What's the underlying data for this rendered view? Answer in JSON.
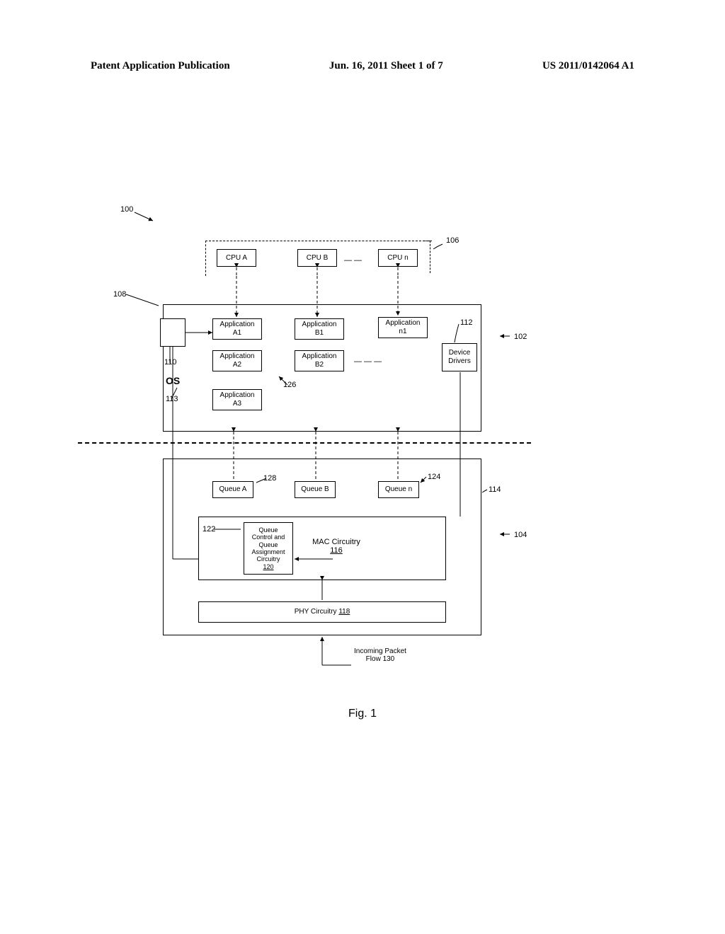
{
  "header": {
    "left": "Patent Application Publication",
    "center": "Jun. 16, 2011  Sheet 1 of 7",
    "right": "US 2011/0142064 A1"
  },
  "refs": {
    "r100": "100",
    "r106": "106",
    "r108": "108",
    "r102": "102",
    "r112": "112",
    "r110": "110",
    "r113": "113",
    "r126": "126",
    "r128": "128",
    "r124": "124",
    "r114": "114",
    "r104": "104",
    "r122": "122",
    "r116u": "116",
    "r120u": "120",
    "r118u": "118",
    "r130": "130"
  },
  "cpu": {
    "a": "CPU A",
    "b": "CPU B",
    "n": "CPU n"
  },
  "apps": {
    "a1": "Application\nA1",
    "a2": "Application\nA2",
    "a3": "Application\nA3",
    "b1": "Application\nB1",
    "b2": "Application\nB2",
    "n1": "Application\nn1"
  },
  "device_drivers": "Device\nDrivers",
  "os": "OS",
  "queues": {
    "a": "Queue A",
    "b": "Queue B",
    "n": "Queue n"
  },
  "qc": "Queue\nControl and\nQueue\nAssignment\nCircuitry",
  "mac": "MAC Circuitry",
  "phy": "PHY Circuitry ",
  "incoming": "Incoming Packet\nFlow 130",
  "figcap": "Fig. 1",
  "dashes": "— —",
  "dashes2": "— — —"
}
